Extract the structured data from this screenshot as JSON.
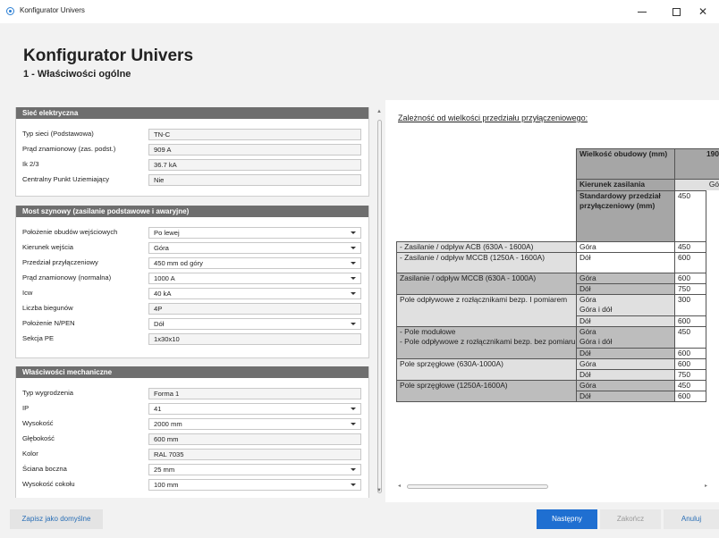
{
  "window": {
    "title": "Konfigurator Univers",
    "minimize": "—",
    "maximize": "☐",
    "close": "✕"
  },
  "header": {
    "title": "Konfigurator Univers",
    "subtitle": "1 - Właściwości ogólne"
  },
  "sections": {
    "siec": {
      "title": "Sieć elektryczna",
      "rows": [
        {
          "label": "Typ sieci (Podstawowa)",
          "value": "TN-C"
        },
        {
          "label": "Prąd znamionowy (zas. podst.)",
          "value": "909 A"
        },
        {
          "label": "Ik 2/3",
          "value": "36.7 kA"
        },
        {
          "label": "Centralny Punkt Uziemiający",
          "value": "Nie"
        }
      ]
    },
    "most": {
      "title": "Most szynowy (zasilanie podstawowe i awaryjne)",
      "rows": [
        {
          "label": "Położenie obudów wejściowych",
          "value": "Po lewej"
        },
        {
          "label": "Kierunek wejścia",
          "value": "Góra"
        },
        {
          "label": "Przedział przyłączeniowy",
          "value": "450 mm od góry"
        },
        {
          "label": "Prąd znamionowy (normalna)",
          "value": "1000 A"
        },
        {
          "label": "Icw",
          "value": "40 kA"
        },
        {
          "label": "Liczba biegunów",
          "value": "4P"
        },
        {
          "label": "Położenie N/PEN",
          "value": "Dół"
        },
        {
          "label": "Sekcja PE",
          "value": "1x30x10"
        }
      ]
    },
    "mech": {
      "title": "Właściwości mechaniczne",
      "rows": [
        {
          "label": "Typ wygrodzenia",
          "value": "Forma 1"
        },
        {
          "label": "IP",
          "value": "41"
        },
        {
          "label": "Wysokość",
          "value": "2000 mm"
        },
        {
          "label": "Głębokość",
          "value": "600 mm"
        },
        {
          "label": "Kolor",
          "value": "RAL 7035"
        },
        {
          "label": "Ściana boczna",
          "value": "25 mm"
        },
        {
          "label": "Wysokość cokołu",
          "value": "100 mm"
        }
      ]
    }
  },
  "dependency": {
    "title": "Zależność od wielkości przedziału przyłączeniowego:",
    "header": {
      "size_label": "Wielkość obudowy (mm)",
      "size_value": "190",
      "direction_label": "Kierunek zasilania",
      "direction_value": "Gó",
      "standard_label": "Standardowy przedział przyłączeniowy (mm)",
      "standard_value": "450"
    },
    "rows": {
      "r1_name": "- Zasilanie / odpływ ACB (630A - 1600A)",
      "r1_dir": "Góra",
      "r1_val": "450",
      "r2_name": "- Zasilanie / odpływ MCCB (1250A - 1600A)",
      "r2_dir": "Dół",
      "r2_val": "600",
      "r3_name": "Zasilanie / odpływ MCCB (630A - 1000A)",
      "r3_dir1": "Góra",
      "r3_val1": "600",
      "r3_dir2": "Dół",
      "r3_val2": "750",
      "r4_name": "Pole odpływowe z rozłącznikami bezp. I pomiarem",
      "r4_dir1": "Góra",
      "r4_val1": "300",
      "r4_dir2": "Góra i dół",
      "r4_dir3": "Dół",
      "r4_val3": "600",
      "r5_name1": "- Pole modułowe",
      "r5_name2": "- Pole odpływowe z rozłącznikami bezp. bez pomiaru",
      "r5_dir1": "Góra",
      "r5_val1": "450",
      "r5_dir2": "Góra i dół",
      "r5_dir3": "Dół",
      "r5_val3": "600",
      "r6_name": "Pole sprzęgłowe (630A-1000A)",
      "r6_dir1": "Góra",
      "r6_val1": "600",
      "r6_dir2": "Dół",
      "r6_val2": "750",
      "r7_name": "Pole sprzęgłowe (1250A-1600A)",
      "r7_dir1": "Góra",
      "r7_val1": "450",
      "r7_dir2": "Dół",
      "r7_val2": "600"
    }
  },
  "footer": {
    "save_default": "Zapisz jako domyślne",
    "next": "Następny",
    "finish": "Zakończ",
    "cancel": "Anuluj"
  },
  "colors": {
    "accent": "#1f6fd1",
    "section_header": "#6e6e6e",
    "table_header": "#a6a6a6"
  }
}
